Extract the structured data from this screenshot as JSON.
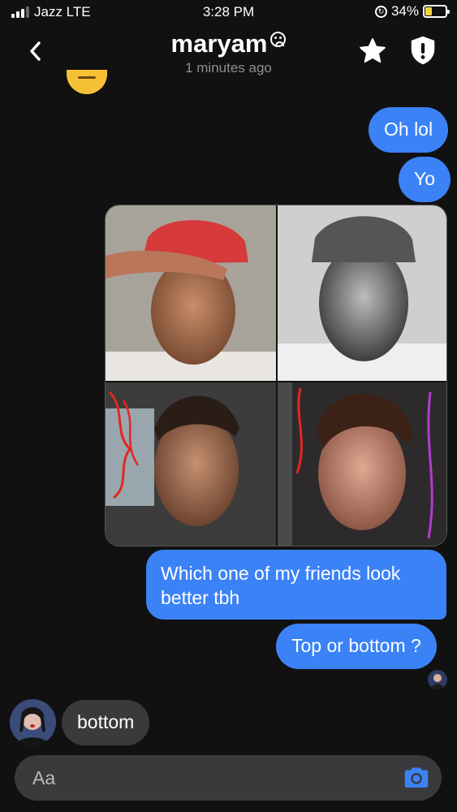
{
  "status_bar": {
    "carrier": "Jazz LTE",
    "time": "3:28 PM",
    "battery_percent": "34%",
    "battery_level": 0.34,
    "battery_color": "#f2d13c"
  },
  "header": {
    "contact_name": "maryam",
    "name_icon": "frown-icon",
    "last_seen": "1 minutes ago",
    "back_icon": "chevron-left-icon",
    "actions": [
      "star-icon",
      "shield-alert-icon"
    ]
  },
  "messages": [
    {
      "direction": "outgoing",
      "text": "Oh lol"
    },
    {
      "direction": "outgoing",
      "text": "Yo"
    },
    {
      "direction": "outgoing",
      "type": "photo",
      "description_icon": "photo-collage"
    },
    {
      "direction": "outgoing",
      "text": "Which one of my friends look better tbh"
    },
    {
      "direction": "outgoing",
      "text": "Top or bottom ?"
    },
    {
      "direction": "incoming",
      "text": "bottom"
    }
  ],
  "composer": {
    "placeholder": "Aa",
    "camera_icon": "camera-icon"
  },
  "colors": {
    "background": "#111111",
    "outgoing_bubble": "#3b82f7",
    "incoming_bubble": "#3a3a3c",
    "accent": "#3b82f7"
  }
}
